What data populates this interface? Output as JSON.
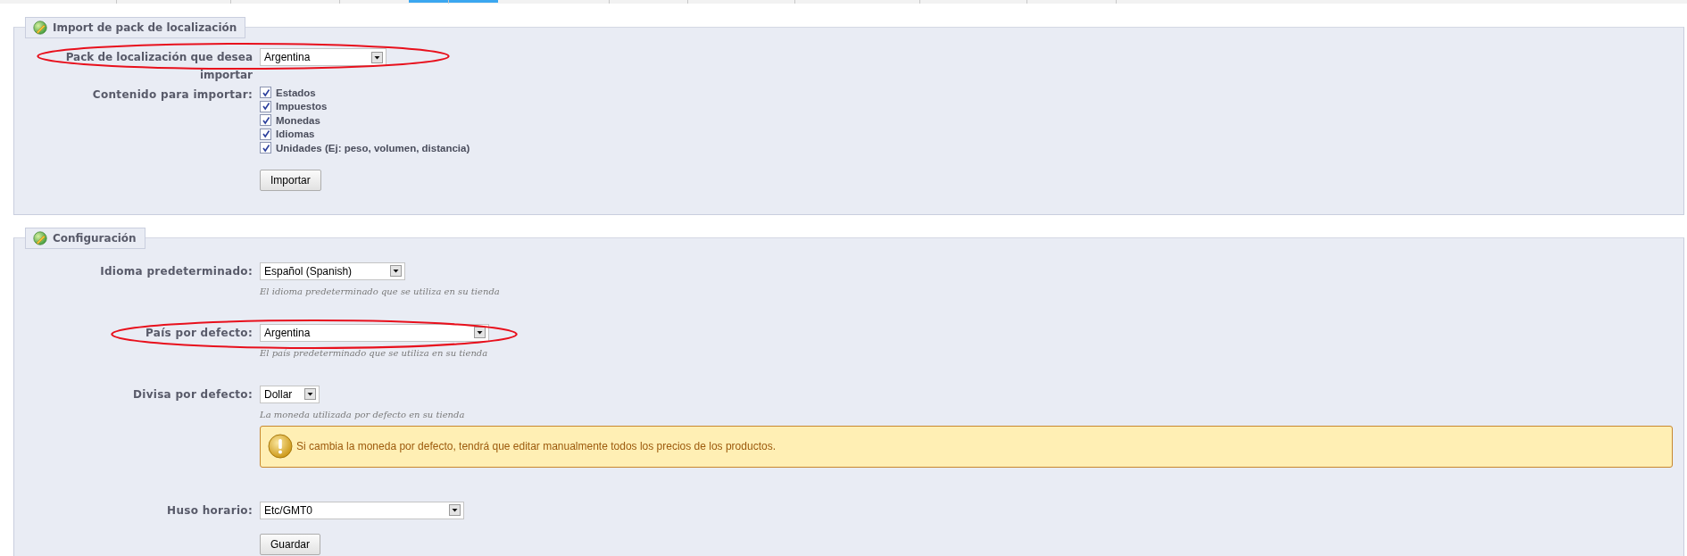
{
  "sections": [
    {
      "title": "Import de pack de localización",
      "fields": [
        {
          "kind": "select",
          "label": "Pack de localización que desea importar",
          "value": "Argentina",
          "highlighted": true
        },
        {
          "kind": "checkboxes",
          "label": "Contenido para importar:",
          "options": [
            {
              "label": "Estados",
              "checked": true
            },
            {
              "label": "Impuestos",
              "checked": true
            },
            {
              "label": "Monedas",
              "checked": true
            },
            {
              "label": "Idiomas",
              "checked": true
            },
            {
              "label": "Unidades (Ej: peso, volumen, distancia)",
              "checked": true
            }
          ]
        },
        {
          "kind": "button",
          "label": "Importar"
        }
      ]
    },
    {
      "title": "Configuración",
      "fields": [
        {
          "kind": "select",
          "label": "Idioma predeterminado:",
          "value": "Español (Spanish)",
          "hint": "El idioma predeterminado que se utiliza en su tienda",
          "highlighted": false
        },
        {
          "kind": "select",
          "label": "País por defecto:",
          "value": "Argentina",
          "hint": "El país predeterminado que se utiliza en su tienda",
          "highlighted": true
        },
        {
          "kind": "select",
          "label": "Divisa por defecto:",
          "value": "Dollar",
          "hint": "La moneda utilizada por defecto en su tienda",
          "warning": "Si cambia la moneda por defecto, tendrá que editar manualmente todos los precios de los productos.",
          "highlighted": false
        },
        {
          "kind": "select",
          "label": "Huso horario:",
          "value": "Etc/GMT0",
          "highlighted": false
        },
        {
          "kind": "button",
          "label": "Guardar"
        }
      ]
    }
  ]
}
